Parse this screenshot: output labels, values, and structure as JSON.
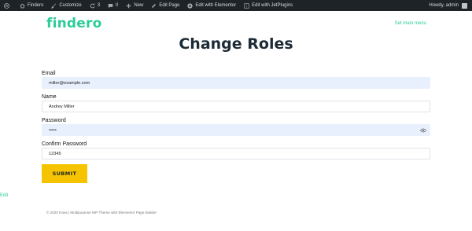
{
  "admin_bar": {
    "site_name": "Findero",
    "customize": "Customize",
    "updates_count": "3",
    "comments_count": "0",
    "new": "New",
    "edit_page": "Edit Page",
    "edit_elementor": "Edit with Elementor",
    "edit_jetplugins": "Edit with JetPlugins",
    "howdy": "Howdy, admin"
  },
  "header": {
    "logo": "findero",
    "menu_link": "Set main menu"
  },
  "page": {
    "title": "Change Roles"
  },
  "form": {
    "email_label": "Email",
    "email_value": "miller@example.com",
    "name_label": "Name",
    "name_value": "Andrey Miller",
    "password_label": "Password",
    "password_value": "•••••",
    "confirm_label": "Confirm Password",
    "confirm_value": "12345",
    "submit_label": "SUBMIT"
  },
  "edit_link": "Edit",
  "footer": {
    "text": "© 2020 Kava | Multipurpose WP Theme with Elementor Page Builder"
  },
  "colors": {
    "accent": "#2ecc9a",
    "button": "#f5c300",
    "admin_bar": "#1d2327",
    "autofill": "#e8f0fe"
  }
}
